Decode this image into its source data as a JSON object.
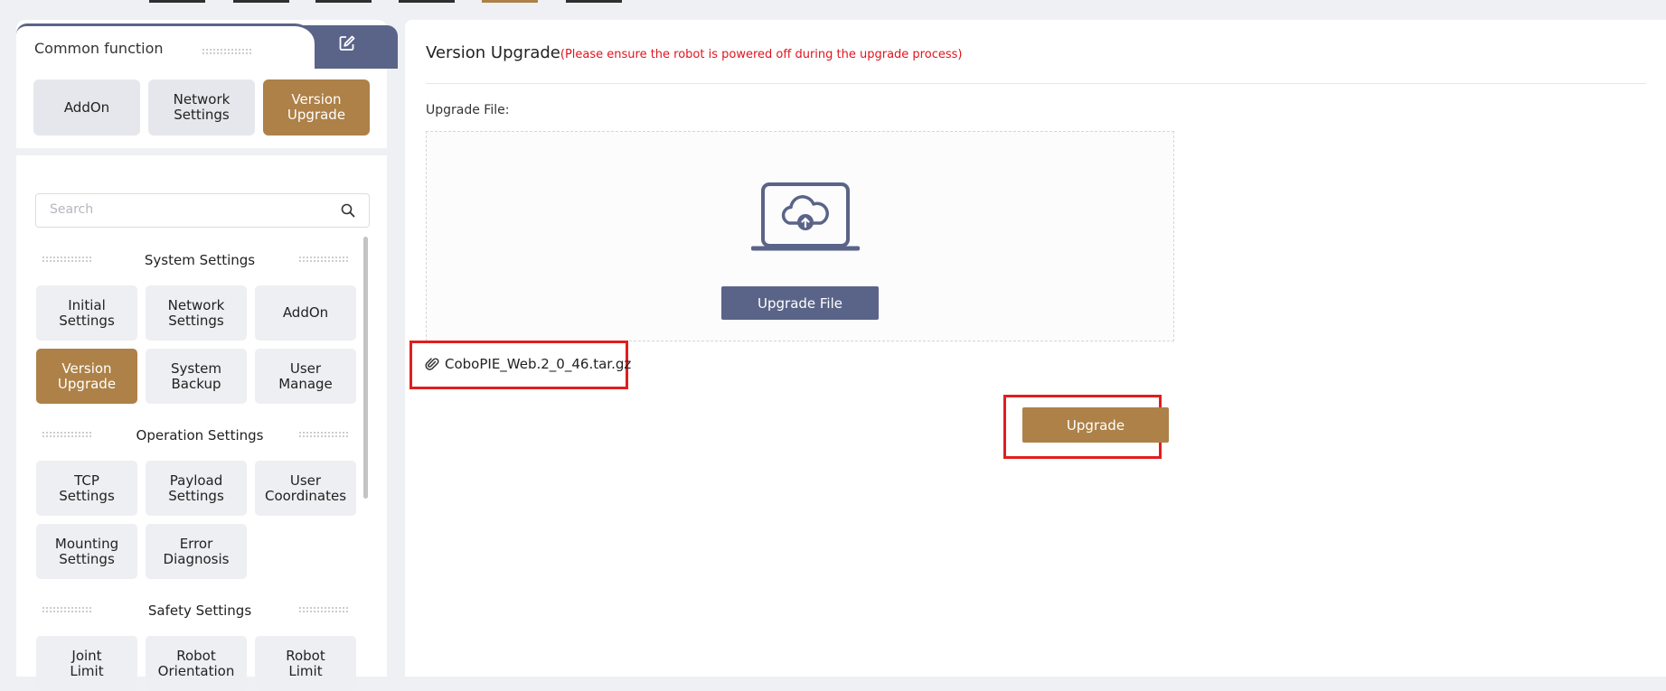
{
  "common_function": {
    "title": "Common function",
    "edit_icon": "edit-icon",
    "buttons": [
      {
        "label": "AddOn",
        "active": false
      },
      {
        "label": "Network\nSettings",
        "active": false
      },
      {
        "label": "Version\nUpgrade",
        "active": true
      }
    ]
  },
  "menu": {
    "search_placeholder": "Search",
    "sections": [
      {
        "title": "System Settings",
        "items": [
          {
            "label": "Initial\nSettings",
            "active": false
          },
          {
            "label": "Network\nSettings",
            "active": false
          },
          {
            "label": "AddOn",
            "active": false
          },
          {
            "label": "Version\nUpgrade",
            "active": true
          },
          {
            "label": "System\nBackup",
            "active": false
          },
          {
            "label": "User\nManage",
            "active": false
          }
        ]
      },
      {
        "title": "Operation Settings",
        "items": [
          {
            "label": "TCP\nSettings",
            "active": false
          },
          {
            "label": "Payload\nSettings",
            "active": false
          },
          {
            "label": "User\nCoordinates",
            "active": false
          },
          {
            "label": "Mounting\nSettings",
            "active": false
          },
          {
            "label": "Error\nDiagnosis",
            "active": false
          }
        ]
      },
      {
        "title": "Safety Settings",
        "items": [
          {
            "label": "Joint\nLimit",
            "active": false
          },
          {
            "label": "Robot\nOrientation",
            "active": false
          },
          {
            "label": "Robot\nLimit",
            "active": false
          }
        ]
      }
    ]
  },
  "main": {
    "title": "Version Upgrade",
    "warning": "(Please ensure the robot is powered off during the upgrade process)",
    "file_label": "Upgrade File:",
    "upload_button": "Upgrade File",
    "selected_file": "CoboPIE_Web.2_0_46.tar.gz",
    "upgrade_button": "Upgrade"
  },
  "colors": {
    "accent_gold": "#ad8147",
    "accent_slate": "#5a6488",
    "highlight_red": "#e01e1e",
    "warning_red": "#e0141e"
  }
}
